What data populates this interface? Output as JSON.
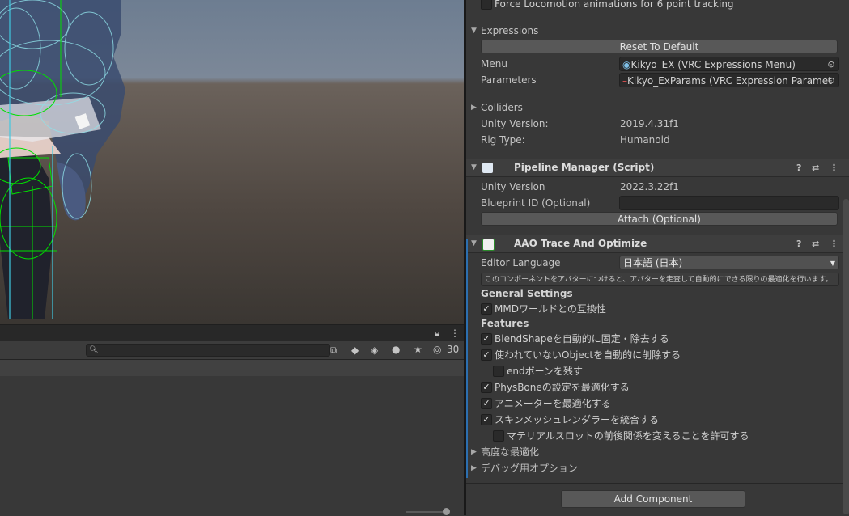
{
  "scene": {},
  "bottom_panel": {
    "lock_icon": "lock-icon",
    "menu_icon": "kebab-menu-icon",
    "search": {
      "value": "",
      "placeholder": ""
    },
    "hidden_count": "30"
  },
  "inspector": {
    "force_locomotion_label": "Force Locomotion animations for 6 point tracking",
    "expressions": {
      "label": "Expressions",
      "reset_button": "Reset To Default",
      "menu_label": "Menu",
      "menu_value": "Kikyo_EX (VRC Expressions Menu)",
      "params_label": "Parameters",
      "params_value": "Kikyo_ExParams (VRC Expression Paramet"
    },
    "colliders_label": "Colliders",
    "unity_version_label": "Unity Version:",
    "unity_version_value": "2019.4.31f1",
    "rig_type_label": "Rig Type:",
    "rig_type_value": "Humanoid",
    "pipeline": {
      "title": "Pipeline Manager (Script)",
      "unity_version_label": "Unity Version",
      "unity_version_value": "2022.3.22f1",
      "blueprint_label": "Blueprint ID (Optional)",
      "blueprint_value": "",
      "attach_button": "Attach (Optional)"
    },
    "aao": {
      "title": "AAO Trace And Optimize",
      "editor_language_label": "Editor Language",
      "editor_language_value": "日本語 (日本)",
      "help_text": "このコンポーネントをアバターにつけると、アバターを走査して自動的にできる限りの最適化を行います。",
      "general_settings": "General Settings",
      "mmd_compat": {
        "label": "MMDワールドとの互換性",
        "checked": true
      },
      "features": "Features",
      "items": [
        {
          "label": "BlendShapeを自動的に固定・除去する",
          "checked": true,
          "indent": false
        },
        {
          "label": "使われていないObjectを自動的に削除する",
          "checked": true,
          "indent": false
        },
        {
          "label": "endボーンを残す",
          "checked": false,
          "indent": true
        },
        {
          "label": "PhysBoneの設定を最適化する",
          "checked": true,
          "indent": false
        },
        {
          "label": "アニメーターを最適化する",
          "checked": true,
          "indent": false
        },
        {
          "label": "スキンメッシュレンダラーを統合する",
          "checked": true,
          "indent": false
        },
        {
          "label": "マテリアルスロットの前後関係を変えることを許可する",
          "checked": false,
          "indent": true
        }
      ],
      "advanced_label": "高度な最適化",
      "debug_label": "デバッグ用オプション"
    },
    "add_component_button": "Add Component",
    "check_glyph": "✓",
    "help_glyph": "?",
    "settings_glyph": "⇄",
    "kebab_glyph": "⋮",
    "arrow_down": "▼",
    "arrow_right": "▶",
    "picker_glyph": "⊙"
  }
}
